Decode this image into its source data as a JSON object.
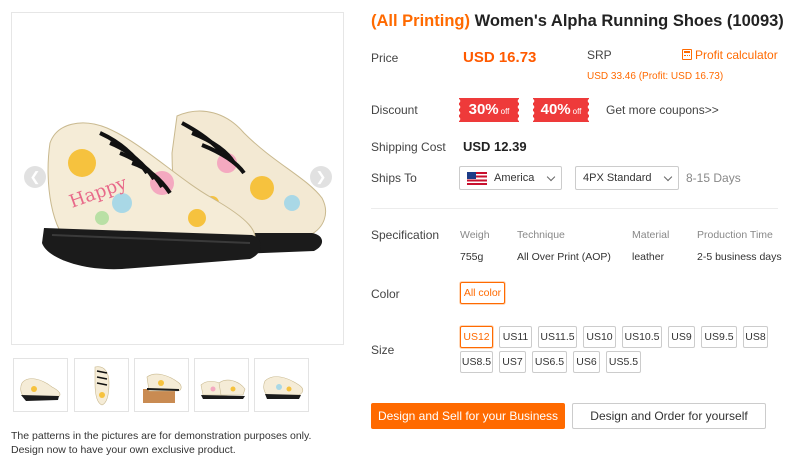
{
  "product": {
    "tag": "(All Printing)",
    "title": " Women's Alpha Running Shoes (10093)"
  },
  "colors": {
    "accent": "#ff6a00",
    "coupon": "#ee3a3a",
    "shoe_sole": "#1b1b1b",
    "shoe_upper": "#f5ecd7"
  },
  "gallery": {
    "prev_icon": "chevron-left-icon",
    "next_icon": "chevron-right-icon",
    "thumbnail_count": 5,
    "disclaimer_line1": "The patterns in the pictures are for demonstration purposes only.",
    "disclaimer_line2": "Design now to have your own exclusive product."
  },
  "price": {
    "label": "Price",
    "value": "USD 16.73",
    "srp_label": "SRP",
    "srp_detail": "USD 33.46 (Profit: USD 16.73)",
    "profit_calc": "Profit calculator",
    "profit_calc_icon": "calculator-icon"
  },
  "discount": {
    "label": "Discount",
    "coupons": [
      {
        "pct": "30%",
        "off": "off"
      },
      {
        "pct": "40%",
        "off": "off"
      }
    ],
    "more": "Get more coupons>>"
  },
  "shipping": {
    "cost_label": "Shipping Cost",
    "cost": "USD 12.39",
    "ships_to_label": "Ships To",
    "country": "America",
    "country_icon": "us-flag-icon",
    "method": "4PX Standard",
    "days": "8-15 Days"
  },
  "specification": {
    "label": "Specification",
    "columns": [
      {
        "head": "Weigh",
        "value": "755g"
      },
      {
        "head": "Technique",
        "value": "All Over Print (AOP)"
      },
      {
        "head": "Material",
        "value": "leather"
      },
      {
        "head": "Production Time",
        "value": "2-5 business days"
      }
    ]
  },
  "color": {
    "label": "Color",
    "options": [
      "All color"
    ],
    "selected": "All color"
  },
  "size": {
    "label": "Size",
    "options": [
      "US12",
      "US11",
      "US11.5",
      "US10",
      "US10.5",
      "US9",
      "US9.5",
      "US8",
      "US8.5",
      "US7",
      "US6.5",
      "US6",
      "US5.5"
    ],
    "selected": "US12"
  },
  "actions": {
    "primary": "Design and Sell for your Business",
    "secondary": "Design and Order for yourself"
  }
}
